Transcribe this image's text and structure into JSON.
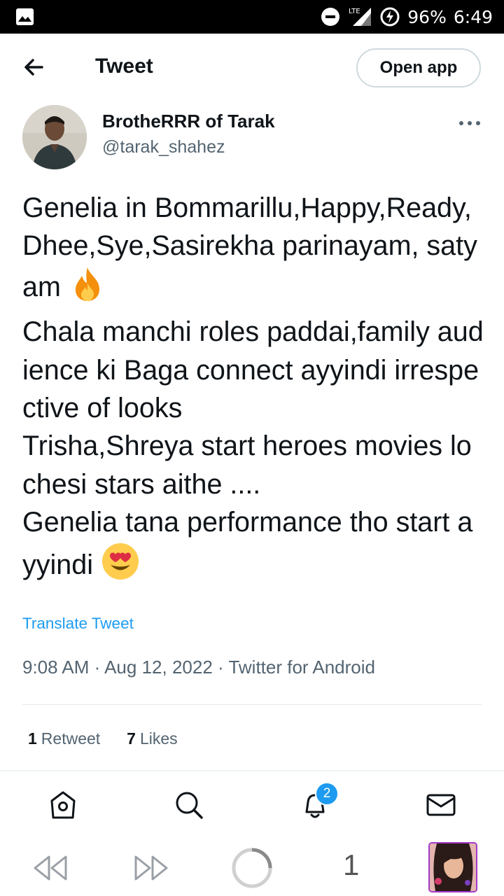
{
  "status_bar": {
    "network": "LTE",
    "battery": "96%",
    "time": "6:49"
  },
  "header": {
    "title": "Tweet",
    "open_app": "Open app"
  },
  "tweet": {
    "author_name": "BrotheRRR of Tarak",
    "handle": "@tarak_shahez",
    "text_line1": "Genelia in Bommarillu,Happy,Ready,Dhee,Sye,Sasirekha parinayam, satyam ",
    "text_line2": "Chala manchi roles paddai,family audience ki Baga connect ayyindi irrespective of looks\nTrisha,Shreya start heroes movies lo  chesi stars aithe ....\nGenelia tana performance tho start ayyindi ",
    "translate": "Translate Tweet",
    "time": "9:08 AM",
    "date": "Aug 12, 2022",
    "source": "Twitter for Android",
    "retweets_count": "1",
    "retweets_label": "Retweet",
    "likes_count": "7",
    "likes_label": "Likes"
  },
  "tabs": {
    "notifications_badge": "2"
  },
  "nav": {
    "tab_count": "1"
  },
  "colors": {
    "accent": "#1d9bf0",
    "secondary_text": "#536471"
  }
}
